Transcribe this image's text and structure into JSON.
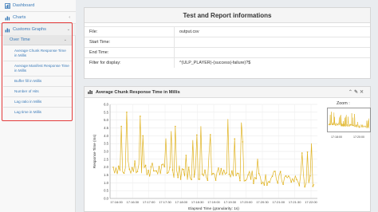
{
  "sidebar": {
    "dashboard": "Dashboard",
    "charts": "Charts",
    "custom_graphs": "Customs Graphs",
    "over_time": "Over Time",
    "sub_items": [
      "Average Chunk Response Time in Millis",
      "Average Manifest Response Time in Millis",
      "Buffer fill in Millis",
      "Number of Hits",
      "Lag ratio in Millis",
      "Lag time in Millis"
    ]
  },
  "info": {
    "title": "Test and Report informations",
    "rows": [
      {
        "label": "File:",
        "value": "output.csv"
      },
      {
        "label": "Start Time:",
        "value": ""
      },
      {
        "label": "End Time:",
        "value": ""
      },
      {
        "label": "Filter for display:",
        "value": "^(ULP_PLAYER)-(success|-failure)?$"
      }
    ]
  },
  "chart_panel": {
    "title": "Average Chunk Response Time in Millis",
    "zoom_label": "Zoom :"
  },
  "chart_data": {
    "type": "line",
    "ylabel": "Response Time (ms)",
    "xlabel": "Elapsed Time (granularity: 1s)",
    "ylim": [
      0,
      6.0
    ],
    "yticks": [
      "0.0",
      "0.5",
      "1.0",
      "1.5",
      "2.0",
      "2.5",
      "3.0",
      "3.5",
      "4.0",
      "4.5",
      "5.0",
      "5.5",
      "6.0"
    ],
    "xticks": [
      "17:16:00",
      "17:16:30",
      "17:17:00",
      "17:17:30",
      "17:18:00",
      "17:18:30",
      "17:19:00",
      "17:19:30",
      "17:20:00",
      "17:20:30",
      "17:21:00",
      "17:21:30",
      "17:22:00"
    ],
    "zoom_xticks": [
      "17:18:00",
      "17:20:00"
    ],
    "series_color": "#e0b321",
    "grid": true
  },
  "colors": {
    "link": "#3a7ab8",
    "highlight": "#e43b3b",
    "series": "#e0b321"
  }
}
